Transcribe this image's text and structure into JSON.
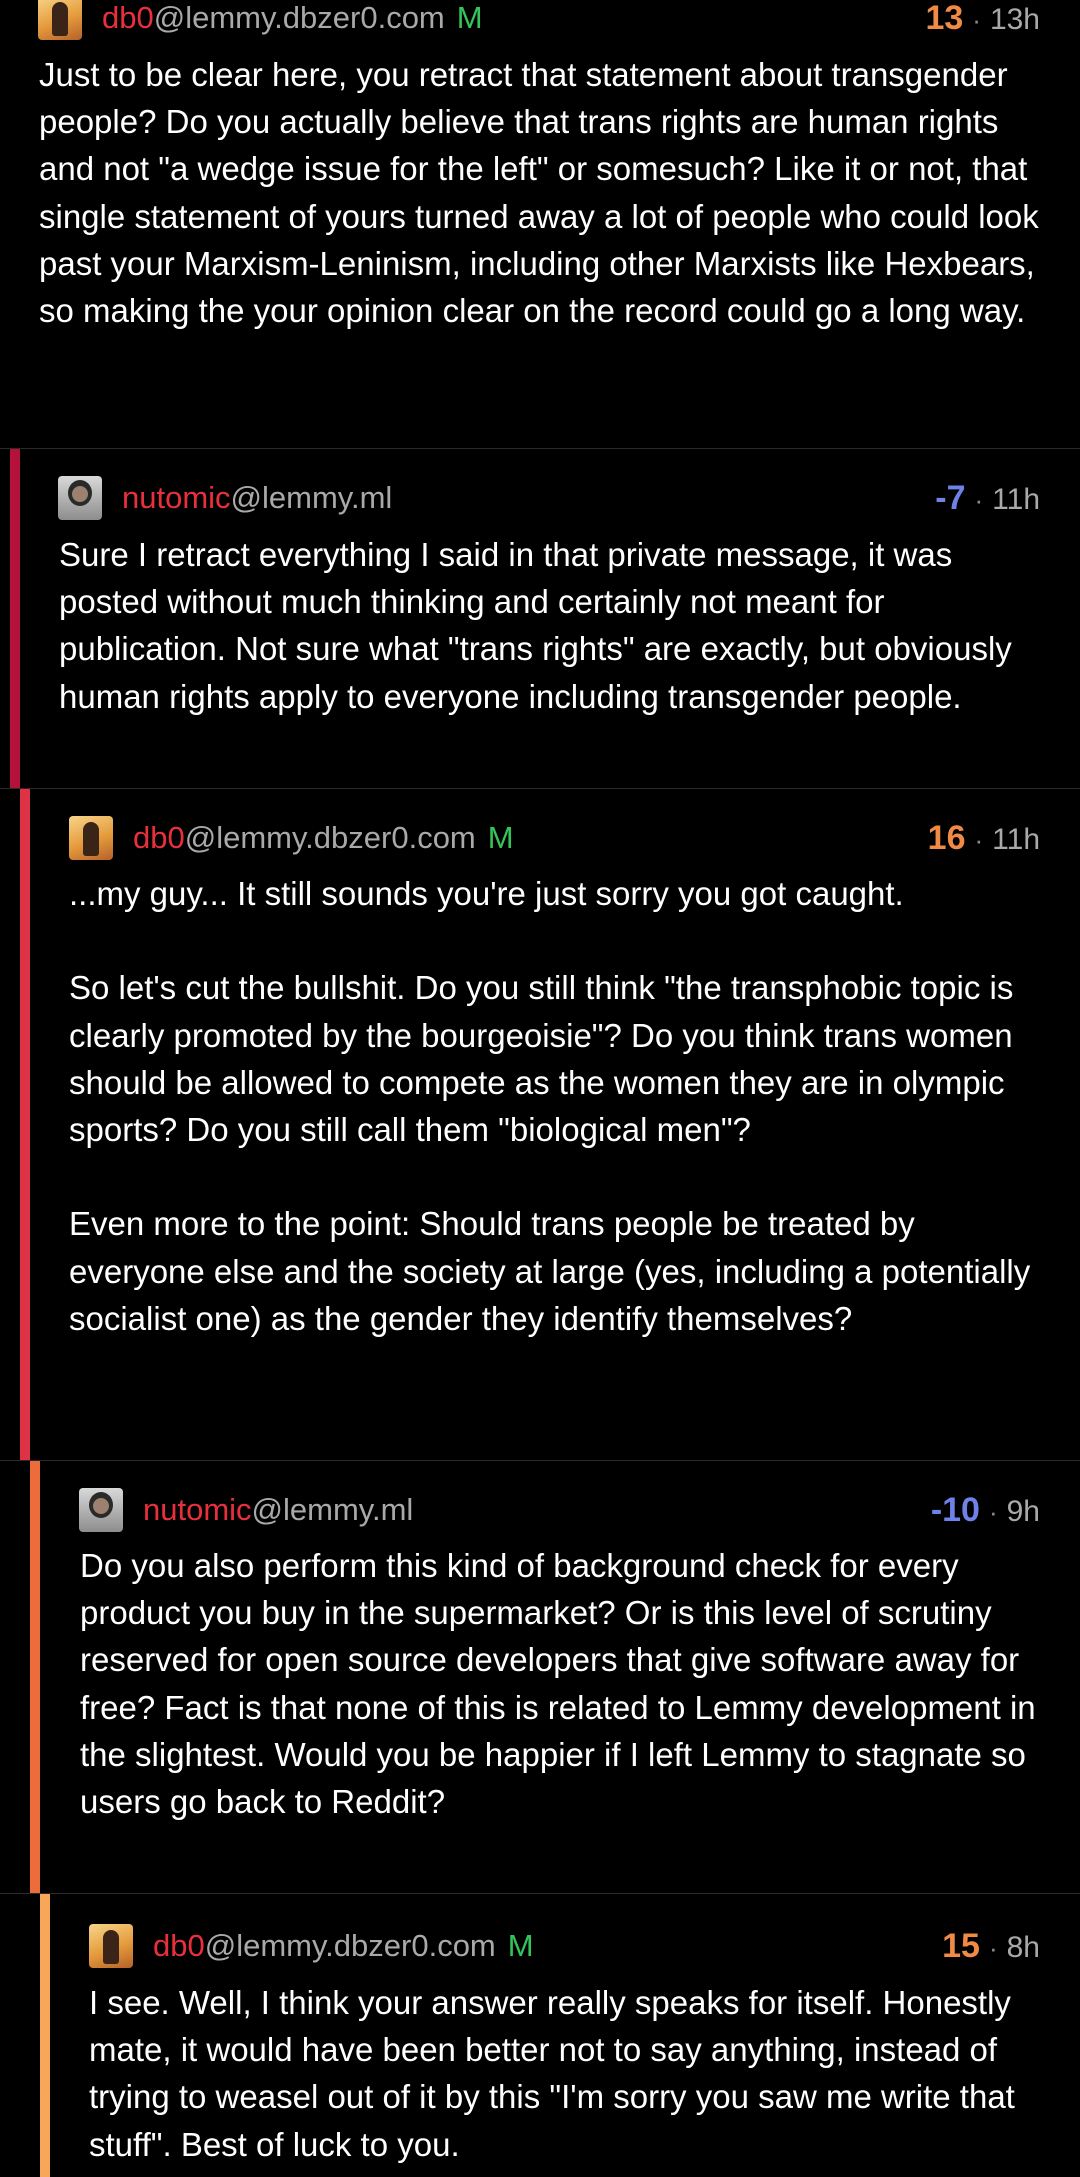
{
  "comments": [
    {
      "username": "db0",
      "instance": "@lemmy.dbzer0.com",
      "mod_badge": "M",
      "score": "13",
      "separator": "·",
      "time": "13h",
      "paragraphs": [
        "Just to be clear here, you retract that statement about transgender people? Do you actually believe that trans rights are human rights and not \"a wedge issue for the left\" or somesuch? Like it or not, that single statement of yours turned away a lot of people who could look past your Marxism-Leninism, including other Marxists like Hexbears, so making the your opinion clear on the record could go a long way."
      ]
    },
    {
      "username": "nutomic",
      "instance": "@lemmy.ml",
      "score": "-7",
      "separator": "·",
      "time": "11h",
      "bar_color": "#b4123a",
      "paragraphs": [
        "Sure I retract everything I said in that private message, it was posted without much thinking and certainly not meant for publication. Not sure what \"trans rights\" are exactly, but obviously human rights apply to everyone including transgender people."
      ]
    },
    {
      "username": "db0",
      "instance": "@lemmy.dbzer0.com",
      "mod_badge": "M",
      "score": "16",
      "separator": "·",
      "time": "11h",
      "bar_color": "#de3245",
      "paragraphs": [
        "...my guy... It still sounds you're just sorry you got caught.",
        "So let's cut the bullshit. Do you still think \"the transphobic topic is clearly promoted by the bourgeoisie\"? Do you think trans women should be allowed to compete as the women they are in olympic sports? Do you still call them \"biological men\"?",
        "Even more to the point: Should trans people be treated by everyone else and the society at large (yes, including a potentially socialist one) as the gender they identify themselves?"
      ]
    },
    {
      "username": "nutomic",
      "instance": "@lemmy.ml",
      "score": "-10",
      "separator": "·",
      "time": "9h",
      "bar_color": "#ee6c3c",
      "paragraphs": [
        "Do you also perform this kind of background check for every product you buy in the supermarket? Or is this level of scrutiny reserved for open source developers that give software away for free? Fact is that none of this is related to Lemmy development in the slightest. Would you be happier if I left Lemmy to stagnate so users go back to Reddit?"
      ]
    },
    {
      "username": "db0",
      "instance": "@lemmy.dbzer0.com",
      "mod_badge": "M",
      "score": "15",
      "separator": "·",
      "time": "8h",
      "bar_color": "#f7a757",
      "paragraphs": [
        "I see. Well, I think your answer really speaks for itself. Honestly mate, it would have been better not to say anything, instead of trying to weasel out of it by this \"I'm sorry you saw me write that stuff\". Best of luck to you."
      ]
    }
  ]
}
